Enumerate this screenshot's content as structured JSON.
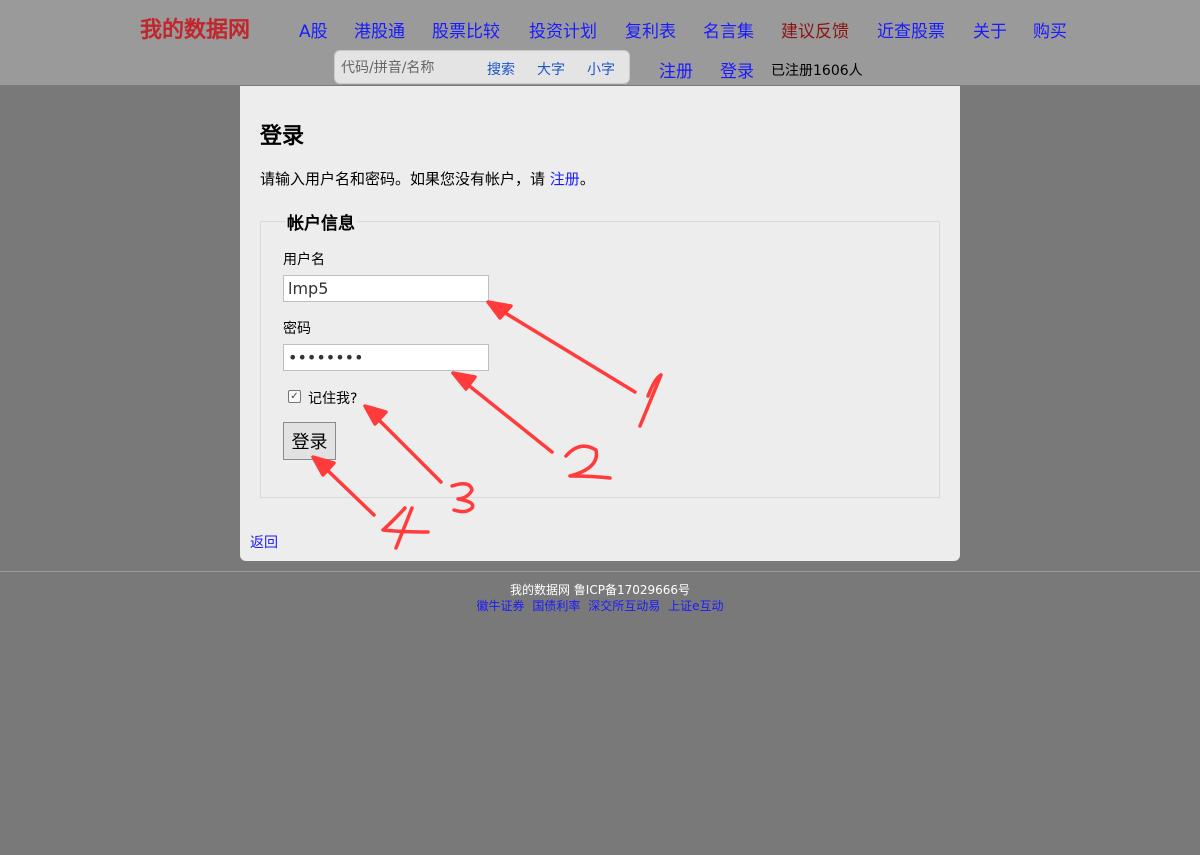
{
  "header": {
    "site_title": "我的数据网",
    "nav": [
      {
        "label": "A股"
      },
      {
        "label": "港股通"
      },
      {
        "label": "股票比较"
      },
      {
        "label": "投资计划"
      },
      {
        "label": "复利表"
      },
      {
        "label": "名言集"
      },
      {
        "label": "建议反馈"
      },
      {
        "label": "近查股票"
      },
      {
        "label": "关于"
      },
      {
        "label": "购买"
      }
    ],
    "search": {
      "placeholder": "代码/拼音/名称",
      "search_label": "搜索",
      "large_font_label": "大字",
      "small_font_label": "小字"
    },
    "register_label": "注册",
    "login_label": "登录",
    "registered_count": "已注册1606人"
  },
  "login": {
    "title": "登录",
    "intro_text": "请输入用户名和密码。如果您没有帐户，请",
    "intro_link": "注册",
    "intro_end": "。",
    "legend": "帐户信息",
    "username_label": "用户名",
    "username_value": "lmp5",
    "password_label": "密码",
    "password_value": "12345678",
    "remember_label": "记住我?",
    "remember_checked": true,
    "submit_label": "登录",
    "back_label": "返回"
  },
  "footer": {
    "text": "我的数据网 鲁ICP备17029666号",
    "links": [
      {
        "label": "徽牛证券"
      },
      {
        "label": "国债利率"
      },
      {
        "label": "深交所互动易"
      },
      {
        "label": "上证e互动"
      }
    ]
  },
  "annotations": {
    "color": "#ff3b3b",
    "labels": [
      "1",
      "2",
      "3",
      "4"
    ]
  }
}
